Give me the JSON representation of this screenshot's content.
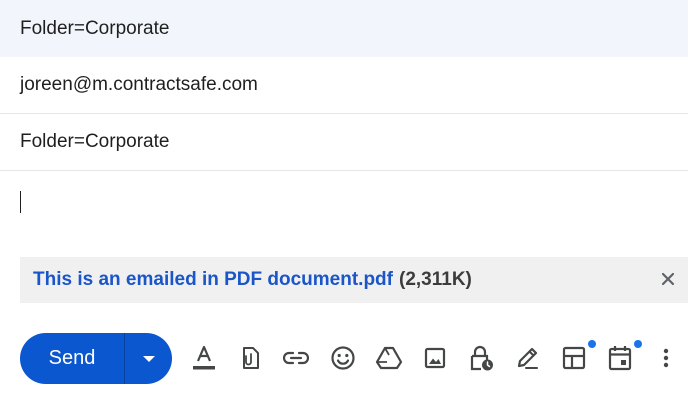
{
  "compose": {
    "window_title": "Folder=Corporate",
    "to": "joreen@m.contractsafe.com",
    "subject": "Folder=Corporate",
    "body": ""
  },
  "attachment": {
    "name": "This is an emailed in PDF document.pdf",
    "size": "(2,311K)"
  },
  "send": {
    "label": "Send"
  },
  "toolbar": {
    "icons": [
      "formatting-options-icon",
      "attach-files-icon",
      "insert-link-icon",
      "insert-emoji-icon",
      "insert-drive-icon",
      "insert-photo-icon",
      "confidential-mode-icon",
      "insert-signature-icon",
      "layouts-icon",
      "schedule-event-icon",
      "more-options-icon"
    ]
  },
  "colors": {
    "accent": "#0b57d0",
    "link": "#1a56c8",
    "header_bg": "#f2f6fc",
    "attachment_bg": "#f0f0f0",
    "badge": "#1a73e8"
  }
}
